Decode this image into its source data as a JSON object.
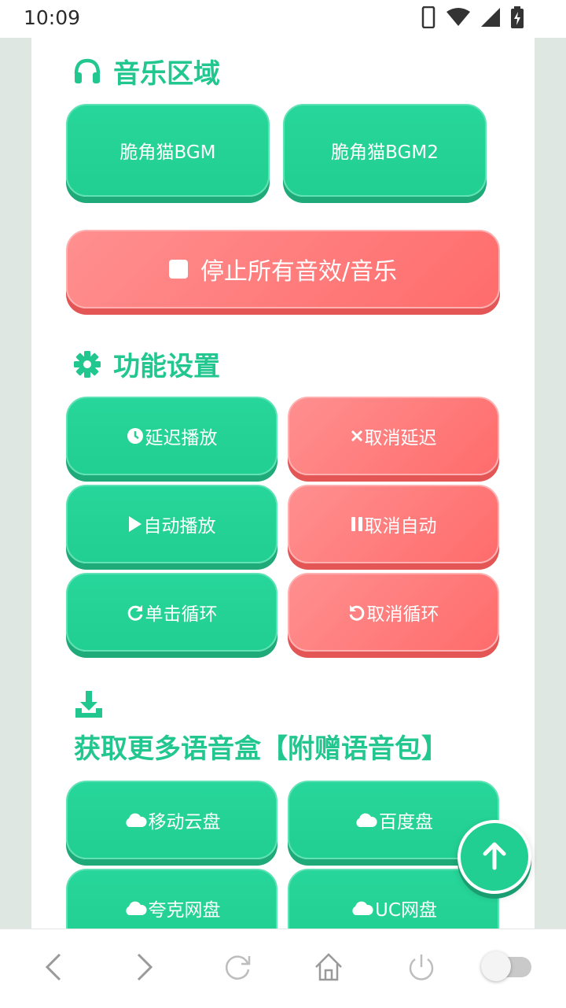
{
  "status": {
    "time": "10:09"
  },
  "music_section": {
    "title": "音乐区域",
    "buttons": [
      {
        "label": "脆角猫BGM"
      },
      {
        "label": "脆角猫BGM2"
      }
    ],
    "stop_label": "停止所有音效/音乐"
  },
  "settings_section": {
    "title": "功能设置",
    "buttons": [
      {
        "label": "延迟播放",
        "icon": "clock-icon"
      },
      {
        "label": "取消延迟",
        "icon": "close-icon"
      },
      {
        "label": "自动播放",
        "icon": "play-icon"
      },
      {
        "label": "取消自动",
        "icon": "pause-icon"
      },
      {
        "label": "单击循环",
        "icon": "redo-icon"
      },
      {
        "label": "取消循环",
        "icon": "undo-icon"
      }
    ]
  },
  "download_section": {
    "title": "获取更多语音盒【附赠语音包】",
    "buttons": [
      {
        "label": "移动云盘",
        "icon": "cloud-icon"
      },
      {
        "label": "百度盘",
        "icon": "cloud-icon"
      },
      {
        "label": "夸克网盘",
        "icon": "cloud-icon"
      },
      {
        "label": "UC网盘",
        "icon": "cloud-icon"
      }
    ]
  },
  "colors": {
    "green": "#22cf92",
    "red": "#ff7272",
    "heading": "#22c78f"
  },
  "browser_nav": {
    "icons": [
      "back-icon",
      "forward-icon",
      "refresh-icon",
      "home-icon",
      "power-icon",
      "toggle-switch"
    ]
  }
}
